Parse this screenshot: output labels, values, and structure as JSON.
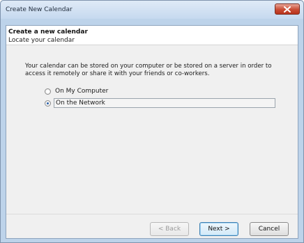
{
  "window": {
    "title": "Create New Calendar"
  },
  "header": {
    "title": "Create a new calendar",
    "subtitle": "Locate your calendar"
  },
  "main": {
    "description": "Your calendar can be stored on your computer or be stored on a server in order to access it remotely or share it with your friends or co-workers.",
    "options": [
      {
        "label": "On My Computer",
        "selected": false
      },
      {
        "label": "On the Network",
        "selected": true
      }
    ]
  },
  "footer": {
    "back_label": "< Back",
    "next_label": "Next >",
    "cancel_label": "Cancel"
  },
  "colors": {
    "titlebar": "#c6d9ef",
    "close_button": "#c94b34",
    "default_button_border": "#3c7fb1"
  }
}
